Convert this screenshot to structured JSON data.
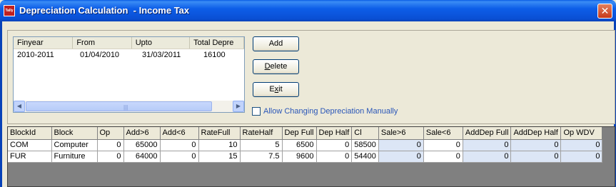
{
  "window": {
    "title": "Depreciation Calculation  - Income Tax",
    "app_icon_text": "Tally",
    "close_glyph": "✕"
  },
  "year_list": {
    "columns": [
      "Finyear",
      "From",
      "Upto",
      "Total Depre"
    ],
    "rows": [
      [
        "2010-2011",
        "01/04/2010",
        "31/03/2011",
        "16100"
      ]
    ],
    "scroll_left": "◀",
    "scroll_right": "▶",
    "scroll_grip": "|||"
  },
  "buttons": {
    "add": "Add",
    "delete_u": "D",
    "delete_rest": "elete",
    "exit_pre": "E",
    "exit_u": "x",
    "exit_rest": "it"
  },
  "allow_manual": {
    "label": "Allow Changing Depreciation Manually",
    "checked": false
  },
  "grid": {
    "columns": [
      "BlockId",
      "Block",
      "Op",
      "Add>6",
      "Add<6",
      "RateFull",
      "RateHalf",
      "Dep Full",
      "Dep Half",
      "Cl",
      "Sale>6",
      "Sale<6",
      "AddDep Full",
      "AddDep Half",
      "Op WDV"
    ],
    "rows": [
      [
        "COM",
        "Computer",
        "0",
        "65000",
        "0",
        "10",
        "5",
        "6500",
        "0",
        "58500",
        "0",
        "0",
        "0",
        "0",
        "0"
      ],
      [
        "FUR",
        "Furniture",
        "0",
        "64000",
        "0",
        "15",
        "7.5",
        "9600",
        "0",
        "54400",
        "0",
        "0",
        "0",
        "0",
        "0"
      ]
    ]
  },
  "colors": {
    "title_bar": "#0a5de6",
    "editable_cell": "#dce6f6",
    "link_text": "#2a56b8"
  }
}
